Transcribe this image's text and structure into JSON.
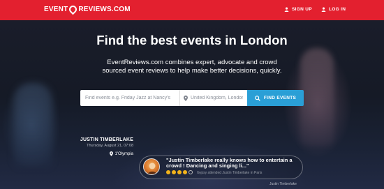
{
  "nav": {
    "logo_left": "EVENT",
    "logo_right": "REVIEWS.COM",
    "signup": "SIGN UP",
    "login": "LOG IN"
  },
  "hero": {
    "headline": "Find the best events in London",
    "subline": "EventReviews.com combines expert, advocate and crowd sourced event reviews to help make better decisions, quickly."
  },
  "search": {
    "what_placeholder": "Find events e.g. Friday Jazz at Nancy's",
    "where_value": "United Kingdom, London",
    "button_label": "FIND EVENTS"
  },
  "review": {
    "artist": "JUSTIN TIMBERLAKE",
    "date": "Thursday, August 21, 07:08",
    "venue": "1'Olympia",
    "quote": "\"Justin Timberlake really knows how to entertain a crowd ! Dancing and singing li...\"",
    "rating": 4,
    "rating_max": 5,
    "attended": "Gypsy attended Justin Timberlake in Paris",
    "author": "Justin Timberlake"
  },
  "colors": {
    "brand_red": "#e3202f",
    "button_blue": "#2a9fd6",
    "star_gold": "#f2b31b"
  },
  "icons": {
    "signup": "user-icon",
    "login": "user-icon",
    "location": "location-pin-icon",
    "search": "search-icon",
    "venue": "map-pin-icon"
  }
}
